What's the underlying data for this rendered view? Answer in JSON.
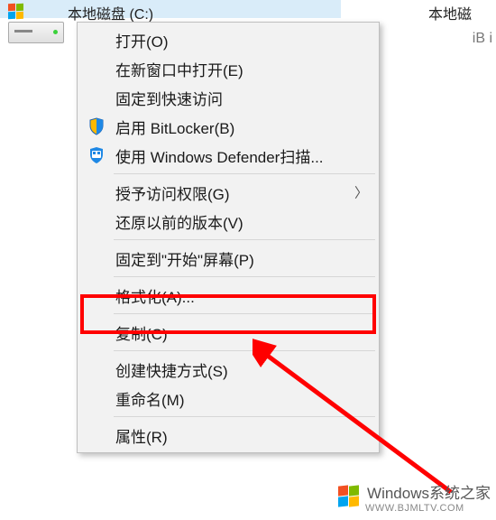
{
  "drives": {
    "selected_label": "本地磁盘 (C:)",
    "other_label": "本地磁",
    "side_text": "iB i"
  },
  "menu": {
    "open": "打开(O)",
    "open_new_window": "在新窗口中打开(E)",
    "pin_quick_access": "固定到快速访问",
    "bitlocker": "启用 BitLocker(B)",
    "defender": "使用 Windows Defender扫描...",
    "grant_access": "授予访问权限(G)",
    "restore_versions": "还原以前的版本(V)",
    "pin_start": "固定到\"开始\"屏幕(P)",
    "format": "格式化(A)...",
    "copy": "复制(C)",
    "create_shortcut": "创建快捷方式(S)",
    "rename": "重命名(M)",
    "properties": "属性(R)"
  },
  "watermark": {
    "text": "Windows系统之家",
    "url": "WWW.BJMLTV.COM"
  }
}
